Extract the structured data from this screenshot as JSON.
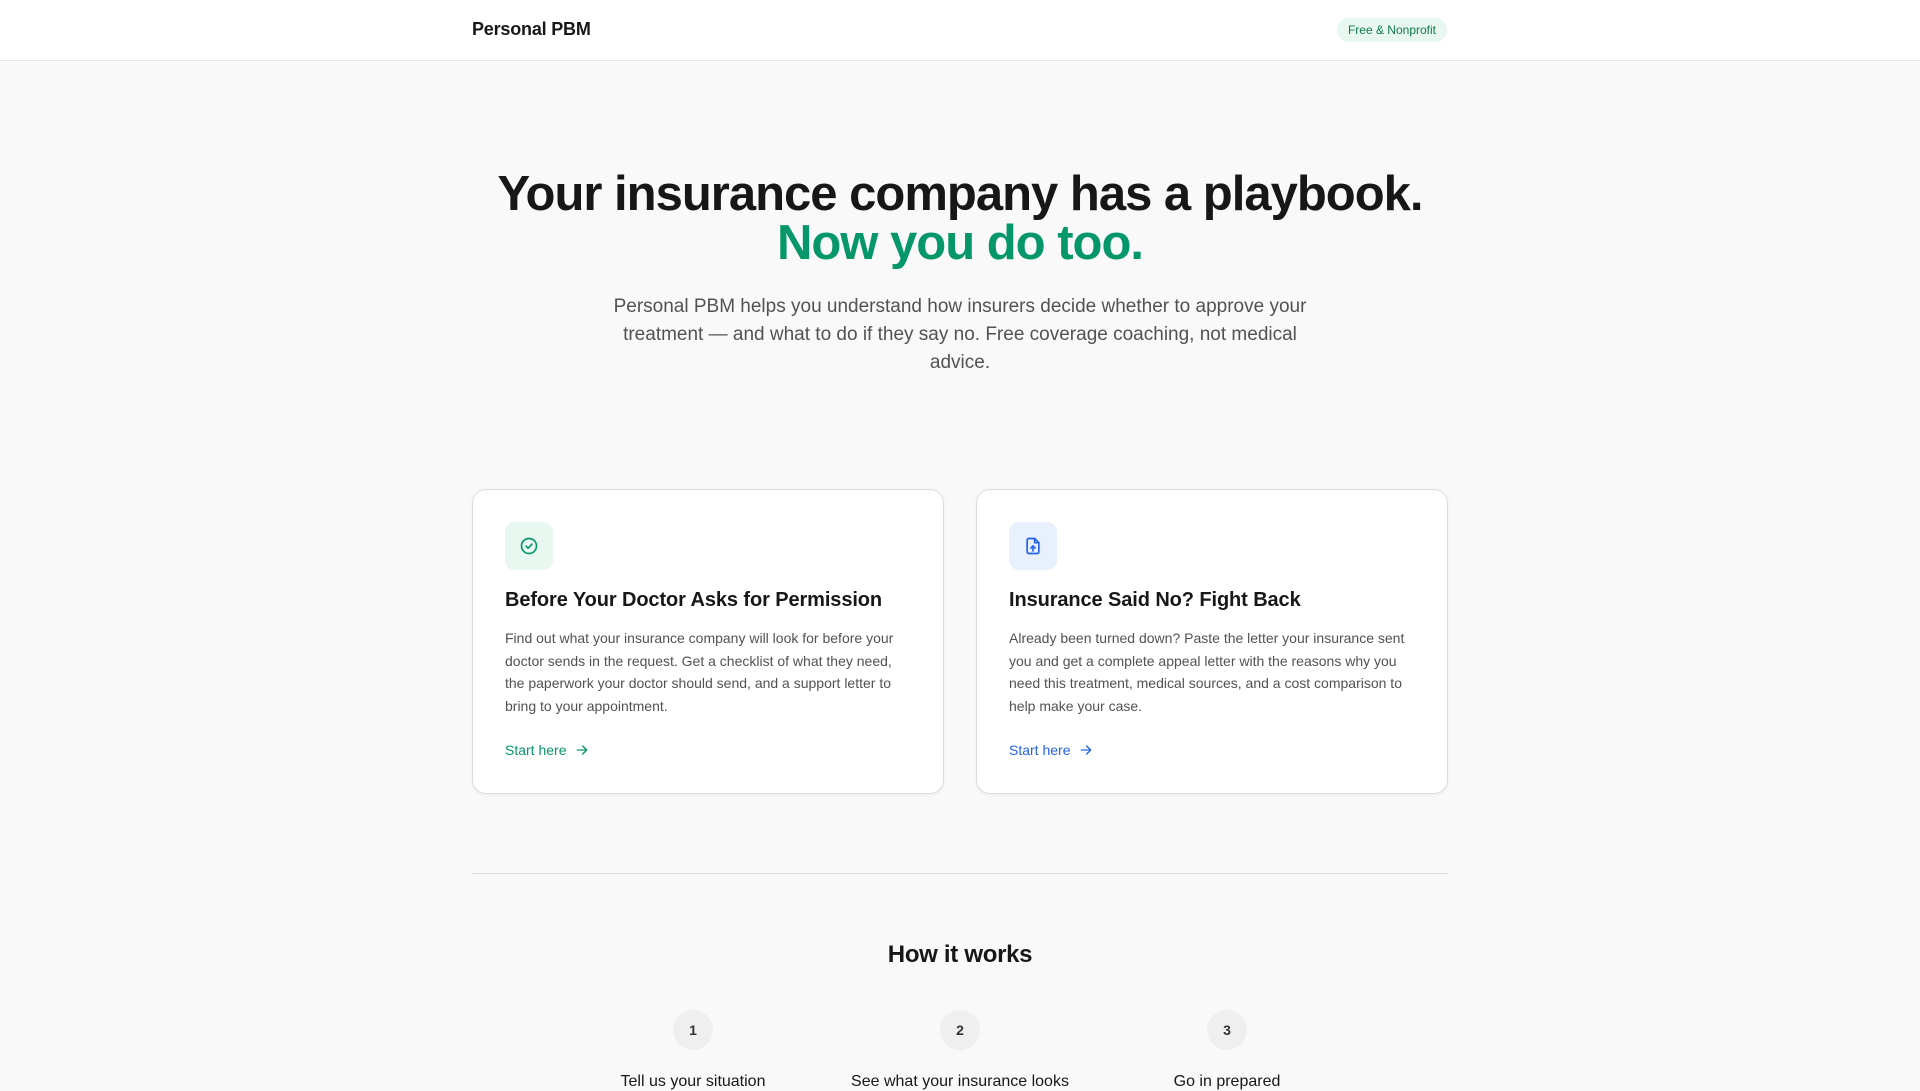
{
  "header": {
    "brand": "Personal PBM",
    "badge": "Free & Nonprofit"
  },
  "hero": {
    "headline": "Your insurance company has a playbook.",
    "headline_accent": "Now you do too.",
    "lead": "Personal PBM helps you understand how insurers decide whether to approve your treatment — and what to do if they say no. Free coverage coaching, not medical advice."
  },
  "cards": [
    {
      "icon": "check-circle-icon",
      "title": "Before Your Doctor Asks for Permission",
      "description": "Find out what your insurance company will look for before your doctor sends in the request. Get a checklist of what they need, the paperwork your doctor should send, and a support letter to bring to your appointment.",
      "link": "Start here",
      "accent": "#059669"
    },
    {
      "icon": "file-upload-icon",
      "title": "Insurance Said No? Fight Back",
      "description": "Already been turned down? Paste the letter your insurance sent you and get a complete appeal letter with the reasons why you need this treatment, medical sources, and a cost comparison to help make your case.",
      "link": "Start here",
      "accent": "#2563eb"
    }
  ],
  "how_it_works": {
    "title": "How it works",
    "steps": [
      {
        "number": "1",
        "label": "Tell us your situation"
      },
      {
        "number": "2",
        "label": "See what your insurance looks"
      },
      {
        "number": "3",
        "label": "Go in prepared"
      }
    ]
  }
}
